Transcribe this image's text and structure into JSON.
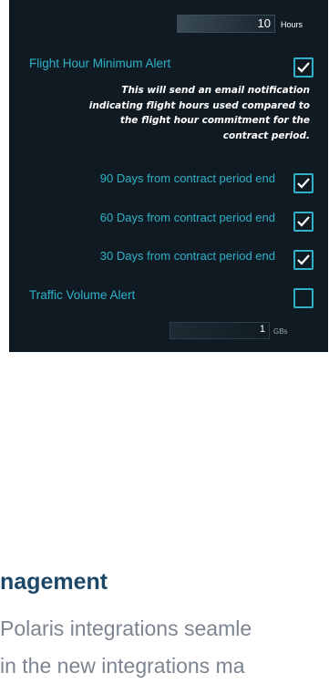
{
  "panel": {
    "hours_field": {
      "value": "10",
      "unit": "Hours"
    },
    "flight_hour_alert": {
      "label": "Flight Hour Minimum Alert",
      "checked": true,
      "description_lines": [
        "This will send an email notification",
        "indicating flight hours used compared to",
        "the flight hour commitment for the",
        "contract period."
      ]
    },
    "day_alerts": [
      {
        "label": "90 Days from contract period end",
        "checked": true
      },
      {
        "label": "60 Days from contract period end",
        "checked": true
      },
      {
        "label": "30 Days from contract period end",
        "checked": true
      }
    ],
    "traffic_alert": {
      "label": "Traffic Volume Alert",
      "checked": false
    },
    "gb_field": {
      "value": "1",
      "unit": "GBs"
    }
  },
  "article": {
    "heading": "nagement",
    "lines": [
      " Polaris integrations seamle",
      " in the new integrations ma"
    ]
  },
  "colors": {
    "panel_bg": "#0f1a22",
    "accent": "#2fb2c9",
    "heading": "#1c4766",
    "body_text": "#7d8590"
  }
}
